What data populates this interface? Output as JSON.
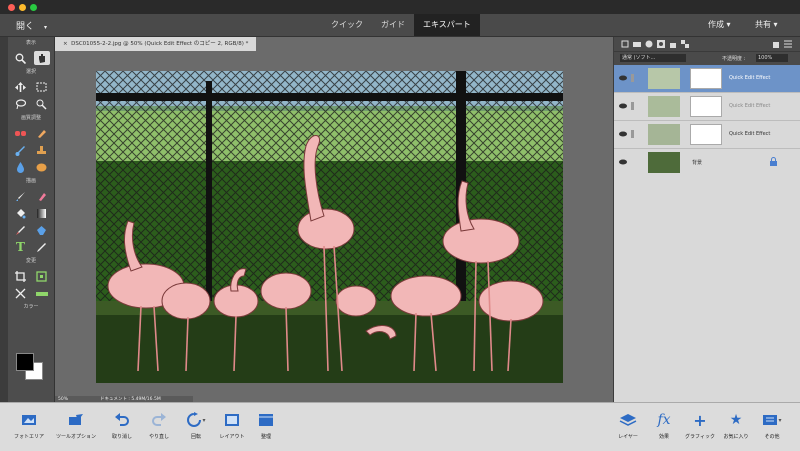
{
  "window": {
    "close_color": "#fd5f57",
    "min_color": "#fdbb2d",
    "max_color": "#29c941"
  },
  "menubar": {
    "open_label": "開く",
    "modes": [
      {
        "label": "クイック"
      },
      {
        "label": "ガイド"
      },
      {
        "label": "エキスパート"
      }
    ],
    "create_label": "作成",
    "share_label": "共有"
  },
  "document": {
    "tab_label": "DSC01055-2-2.jpg @ 50% (Quick Edit Effect のコピー 2, RGB/8) *",
    "zoom_status": "50%",
    "info_status": "ドキュメント : 5.49M/16.5M"
  },
  "toolbar": {
    "sections": [
      "表示",
      "選択",
      "画質調整",
      "描画",
      "変更",
      "カラー"
    ]
  },
  "layers_panel": {
    "blend_mode": "通常 (ソフト...",
    "opacity_label": "不透明度 :",
    "opacity_value": "100%",
    "layers": [
      {
        "name": "Quick Edit Effect",
        "selected": true
      },
      {
        "name": "Quick Edit Effect",
        "selected": false
      },
      {
        "name": "Quick Edit Effect",
        "selected": false
      },
      {
        "name": "背景",
        "selected": false
      }
    ]
  },
  "bottombar": {
    "left": [
      {
        "label": "フォトエリア",
        "icon": "photo-bin-icon"
      },
      {
        "label": "ツールオプション",
        "icon": "tool-options-icon"
      },
      {
        "label": "取り消し",
        "icon": "undo-icon"
      },
      {
        "label": "やり直し",
        "icon": "redo-icon"
      },
      {
        "label": "回転",
        "icon": "rotate-icon"
      },
      {
        "label": "レイアウト",
        "icon": "layout-icon"
      },
      {
        "label": "整理",
        "icon": "organizer-icon"
      }
    ],
    "right": [
      {
        "label": "レイヤー",
        "icon": "layers-icon"
      },
      {
        "label": "効果",
        "icon": "effects-icon"
      },
      {
        "label": "グラフィック",
        "icon": "graphics-icon"
      },
      {
        "label": "お気に入り",
        "icon": "favorites-icon"
      },
      {
        "label": "その他",
        "icon": "more-icon"
      }
    ]
  }
}
